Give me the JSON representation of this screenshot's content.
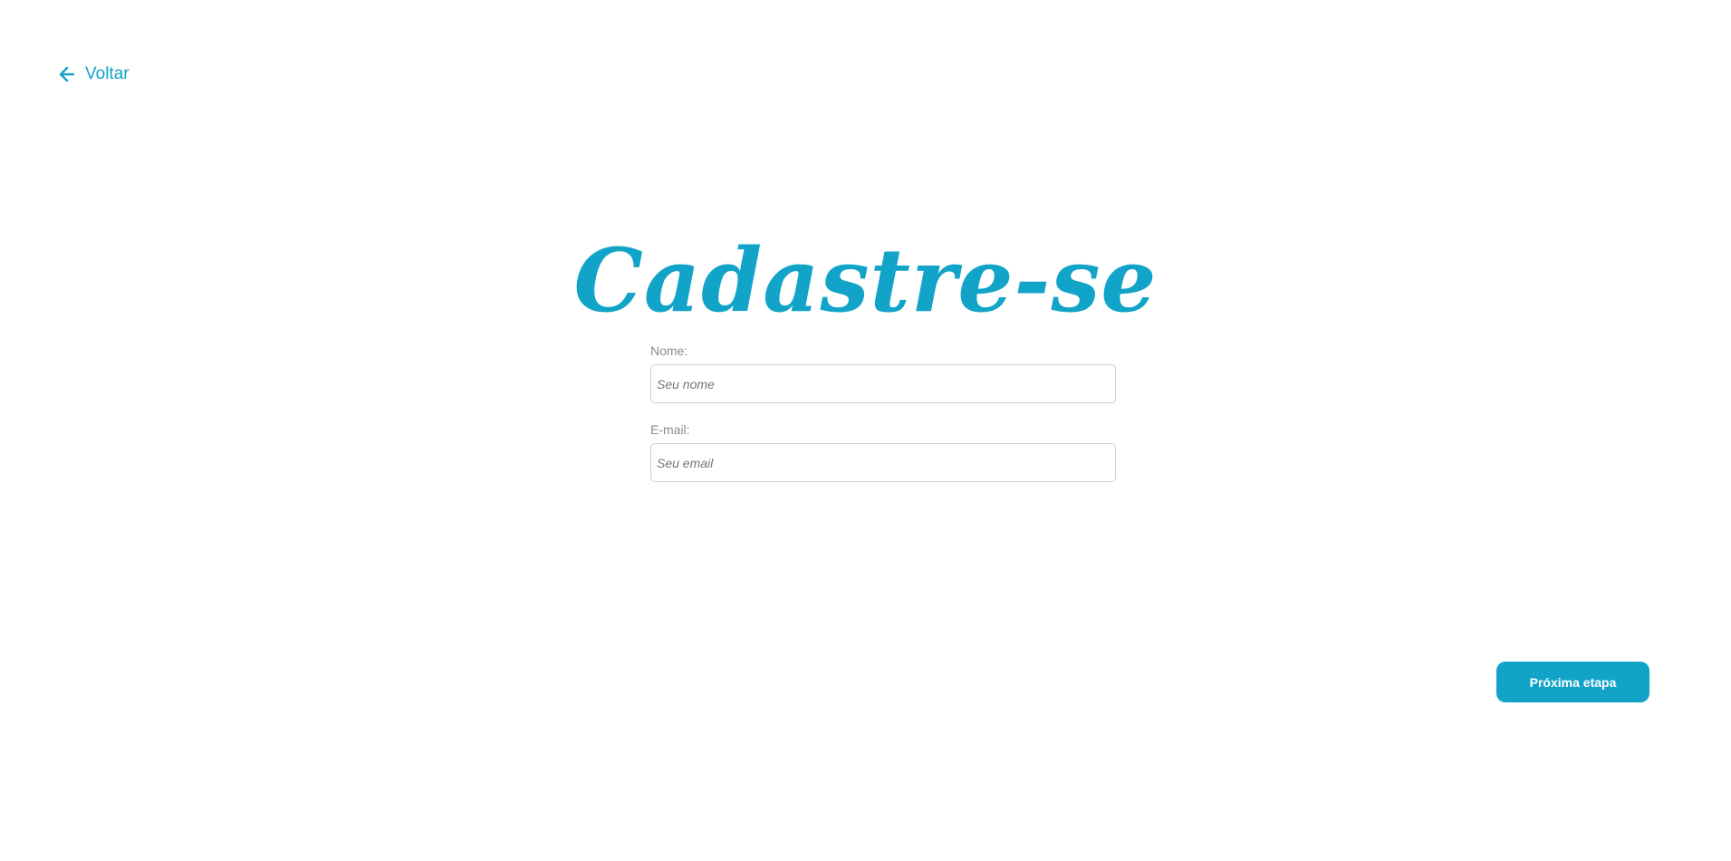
{
  "nav": {
    "back_label": "Voltar",
    "back_icon": "arrow-left-icon"
  },
  "page": {
    "title": "Cadastre-se"
  },
  "form": {
    "name": {
      "label": "Nome:",
      "placeholder": "Seu nome",
      "value": ""
    },
    "email": {
      "label": "E-mail:",
      "placeholder": "Seu email",
      "value": ""
    }
  },
  "actions": {
    "next_label": "Próxima etapa"
  },
  "colors": {
    "accent": "#12a4c8",
    "label": "#8a8a8a",
    "border": "#cfcfcf",
    "background": "#ffffff"
  }
}
